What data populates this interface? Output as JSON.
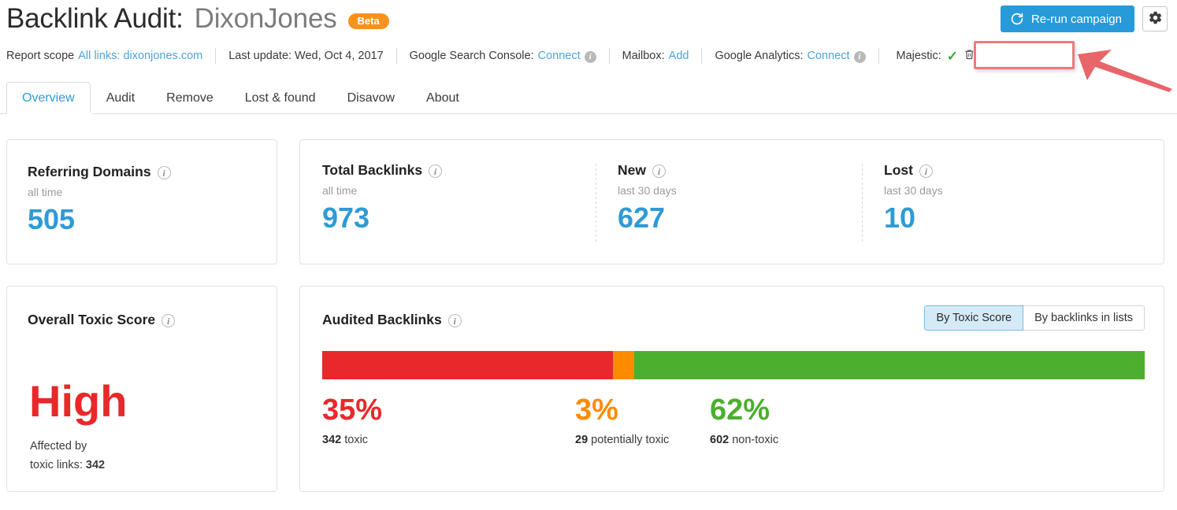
{
  "header": {
    "title_main": "Backlink Audit:",
    "title_sub": "DixonJones",
    "beta_badge": "Beta",
    "rerun_label": "Re-run campaign",
    "rerun_icon": "refresh-icon",
    "settings_icon": "gear-icon",
    "accent_blue": "#279bd9",
    "beta_orange": "#f7921e"
  },
  "scope": {
    "report_scope_label": "Report scope",
    "report_scope_value": "All links: dixonjones.com",
    "last_update": "Last update: Wed, Oct 4, 2017",
    "gsc_label": "Google Search Console:",
    "gsc_action": "Connect",
    "mailbox_label": "Mailbox:",
    "mailbox_action": "Add",
    "ga_label": "Google Analytics:",
    "ga_action": "Connect",
    "majestic_label": "Majestic:",
    "majestic_status_icon": "check-icon",
    "majestic_delete_icon": "trash-icon",
    "annotation_color": "#ec7a80"
  },
  "tabs": [
    {
      "label": "Overview",
      "active": true
    },
    {
      "label": "Audit",
      "active": false
    },
    {
      "label": "Remove",
      "active": false
    },
    {
      "label": "Lost & found",
      "active": false
    },
    {
      "label": "Disavow",
      "active": false
    },
    {
      "label": "About",
      "active": false
    }
  ],
  "referring_domains": {
    "title": "Referring Domains",
    "info_icon": "info-icon",
    "period": "all time",
    "value": "505"
  },
  "metrics": [
    {
      "title": "Total Backlinks",
      "info_icon": "info-icon",
      "period": "all time",
      "value": "973"
    },
    {
      "title": "New",
      "info_icon": "info-icon",
      "period": "last 30 days",
      "value": "627"
    },
    {
      "title": "Lost",
      "info_icon": "info-icon",
      "period": "last 30 days",
      "value": "10"
    }
  ],
  "toxic_score": {
    "title": "Overall Toxic Score",
    "info_icon": "info-icon",
    "level": "High",
    "note_line1": "Affected by",
    "note_line2_prefix": "toxic links:",
    "note_line2_value": "342",
    "level_color": "#e8282b"
  },
  "audited_backlinks": {
    "title": "Audited Backlinks",
    "info_icon": "info-icon",
    "toggle": [
      {
        "label": "By Toxic Score",
        "active": true
      },
      {
        "label": "By backlinks in lists",
        "active": false
      }
    ]
  },
  "chart_data": {
    "type": "bar",
    "title": "Audited Backlinks",
    "orientation": "horizontal-stacked",
    "categories": [
      "toxic",
      "potentially toxic",
      "non-toxic"
    ],
    "values": [
      35,
      3,
      62
    ],
    "counts": [
      342,
      29,
      602
    ],
    "unit": "%",
    "colors": [
      "#e8282b",
      "#fb8c00",
      "#4caf2e"
    ],
    "legend": [
      {
        "pct": "35%",
        "count": "342",
        "label": "toxic",
        "color": "#e8282b"
      },
      {
        "pct": "3%",
        "count": "29",
        "label": "potentially toxic",
        "color": "#fb8c00"
      },
      {
        "pct": "62%",
        "count": "602",
        "label": "non-toxic",
        "color": "#4caf2e"
      }
    ],
    "grid": false,
    "legend_position": "bottom"
  }
}
